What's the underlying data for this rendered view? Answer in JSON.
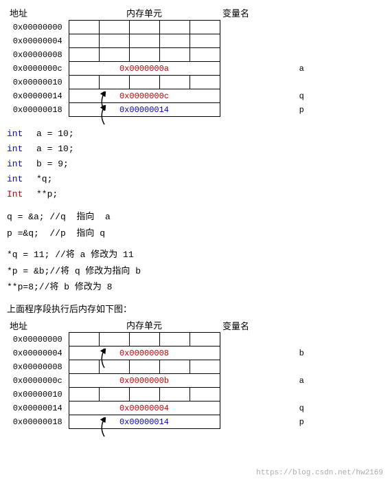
{
  "table1": {
    "headers": [
      "地址",
      "内存单元",
      "变量名"
    ],
    "rows": [
      {
        "addr": "0x00000000",
        "cells": [
          "",
          "",
          "",
          "",
          ""
        ],
        "varname": ""
      },
      {
        "addr": "0x00000004",
        "cells": [
          "",
          "",
          "",
          "",
          ""
        ],
        "varname": ""
      },
      {
        "addr": "0x00000008",
        "cells": [
          "",
          "",
          "",
          "",
          ""
        ],
        "varname": ""
      },
      {
        "addr": "0x0000000c",
        "cells_merged": "0x0000000a",
        "cell_color": "red",
        "varname": "a"
      },
      {
        "addr": "0x00000010",
        "cells": [
          "",
          "",
          "",
          "",
          ""
        ],
        "varname": ""
      },
      {
        "addr": "0x00000014",
        "cells_merged": "0x0000000c",
        "cell_color": "red",
        "varname": "q"
      },
      {
        "addr": "0x00000018",
        "cells_merged": "0x00000014",
        "cell_color": "blue",
        "varname": "p"
      }
    ]
  },
  "code_block1": [
    {
      "keyword": "int",
      "rest": "  a = 10;"
    },
    {
      "keyword": "int",
      "rest": "  a = 10;"
    },
    {
      "keyword": "int",
      "rest": "  b = 9;"
    },
    {
      "keyword": "int",
      "rest": "  *q;"
    },
    {
      "keyword": "Int",
      "rest": "  **p;"
    }
  ],
  "annotations1": [
    {
      "line": "q = &a; //q  指向  a"
    },
    {
      "line": "p =&q;  //p  指向 q"
    }
  ],
  "ops": [
    {
      "line": "*q = 11; //将 a 修改为 11"
    },
    {
      "line": "*p = &b;//将 q 修改为指向 b"
    },
    {
      "line": "**p=8;//将 b 修改为 8"
    }
  ],
  "section2_label": "上面程序段执行后内存如下图：",
  "table2": {
    "headers": [
      "地址",
      "内存单元",
      "变量名"
    ],
    "rows": [
      {
        "addr": "0x00000000",
        "cells": [
          "",
          "",
          "",
          "",
          ""
        ],
        "varname": ""
      },
      {
        "addr": "0x00000004",
        "cells_merged": "0x00000008",
        "cell_color": "red",
        "varname": "b"
      },
      {
        "addr": "0x00000008",
        "cells": [
          "",
          "",
          "",
          "",
          ""
        ],
        "varname": ""
      },
      {
        "addr": "0x0000000c",
        "cells_merged": "0x0000000b",
        "cell_color": "red",
        "varname": "a"
      },
      {
        "addr": "0x00000010",
        "cells": [
          "",
          "",
          "",
          "",
          ""
        ],
        "varname": ""
      },
      {
        "addr": "0x00000014",
        "cells_merged": "0x00000004",
        "cell_color": "red",
        "varname": "q"
      },
      {
        "addr": "0x00000018",
        "cells_merged": "0x00000014",
        "cell_color": "blue",
        "varname": "p"
      }
    ]
  },
  "watermark": "https://blog.csdn.net/hw2169"
}
